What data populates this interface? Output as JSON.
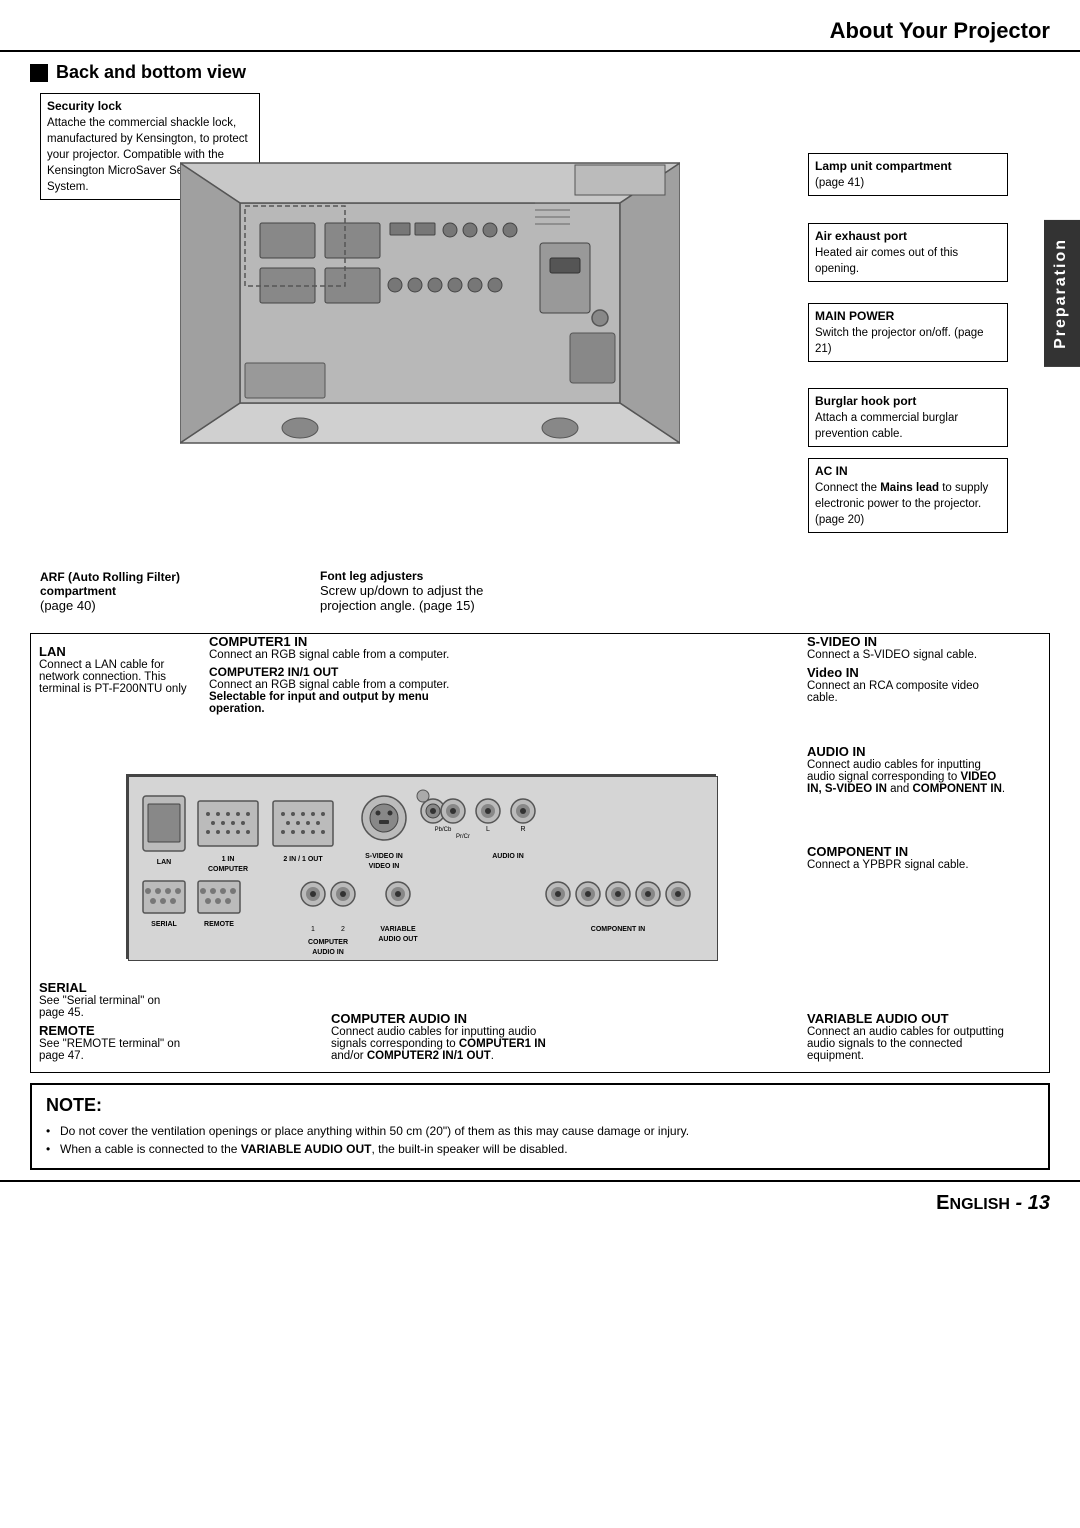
{
  "header": {
    "title": "About Your Projector"
  },
  "side_tab": "Preparation",
  "section": {
    "title": "Back and bottom view"
  },
  "annotations_top_left": {
    "security_lock": {
      "title": "Security lock",
      "lines": [
        "Attache the commercial shackle",
        "lock, manufactured by Kensington,",
        "to protect your projector.",
        "Compatible with the Kensington",
        "MicroSaver Security System."
      ]
    }
  },
  "annotations_top_right": {
    "lamp_unit": {
      "title": "Lamp unit compartment",
      "desc": "(page 41)"
    },
    "air_exhaust": {
      "title": "Air exhaust port",
      "desc": "Heated air comes out of this opening."
    },
    "main_power": {
      "title": "MAIN POWER",
      "desc": "Switch the projector on/off. (page 21)"
    },
    "burglar_hook": {
      "title": "Burglar hook port",
      "desc": "Attach a commercial burglar prevention cable."
    },
    "ac_in": {
      "title": "AC IN",
      "desc": "Connect the Mains lead to supply electronic power to the projector. (page 20)",
      "bold_word": "Mains lead"
    }
  },
  "annotations_bottom_left": {
    "arf": {
      "title": "ARF (Auto Rolling Filter) compartment",
      "desc": "(page 40)"
    },
    "font_leg": {
      "title": "Font leg adjusters",
      "desc": "Screw up/down to adjust the projection angle. (page 15)"
    }
  },
  "annotations_ports_left": {
    "lan": {
      "title": "LAN",
      "desc": "Connect a LAN cable for network connection. This terminal is PT-F200NTU only"
    },
    "computer1": {
      "title": "COMPUTER1 IN",
      "desc": "Connect an RGB signal cable from a computer."
    },
    "computer2": {
      "title": "COMPUTER2 IN/1 OUT",
      "desc": "Connect an RGB signal cable from a computer. Selectable for input and output by menu operation.",
      "bold": "Selectable for input and output by menu operation."
    }
  },
  "annotations_ports_right": {
    "svideo": {
      "title": "S-VIDEO IN",
      "desc": "Connect a S-VIDEO signal cable."
    },
    "video": {
      "title": "Video IN",
      "desc": "Connect an RCA composite video cable."
    },
    "audio_in": {
      "title": "AUDIO IN",
      "desc": "Connect audio cables for inputting audio signal corresponding to VIDEO IN, S-VIDEO IN and COMPONENT IN.",
      "bold": "VIDEO IN, S-VIDEO IN and COMPONENT IN."
    },
    "component_in": {
      "title": "COMPONENT IN",
      "desc": "Connect a YPBPR signal cable."
    }
  },
  "annotations_ports_bottom": {
    "serial": {
      "title": "SERIAL",
      "desc": "See \"Serial terminal\" on page 45."
    },
    "remote": {
      "title": "REMOTE",
      "desc": "See \"REMOTE terminal\" on page 47."
    },
    "computer_audio": {
      "title": "COMPUTER AUDIO IN",
      "desc": "Connect audio cables for inputting audio signals corresponding to COMPUTER1 IN and/or COMPUTER2 IN/1 OUT.",
      "bold": "COMPUTER1 IN and/or COMPUTER2 IN/1 OUT."
    },
    "variable_audio": {
      "title": "VARIABLE AUDIO OUT",
      "desc": "Connect an audio cables for outputting audio signals to the connected equipment."
    }
  },
  "note": {
    "title": "NOTE:",
    "items": [
      "Do not cover the ventilation openings or place anything within 50 cm (20\") of them as this may cause damage or injury.",
      "When a cable is connected to the VARIABLE AUDIO OUT, the built-in speaker will be disabled."
    ]
  },
  "footer": {
    "text": "ENGLISH - 13"
  },
  "port_labels": {
    "row1": [
      "LAN",
      "1 IN",
      "2 IN / 1 OUT",
      "S-VIDEO IN",
      "AUDIO IN"
    ],
    "row1_sub": [
      "",
      "COMPUTER",
      "",
      "VIDEO IN",
      ""
    ],
    "row2": [
      "SERIAL",
      "REMOTE",
      "COMPUTER",
      "VARIABLE",
      "COMPONENT IN"
    ],
    "row2_sub": [
      "",
      "",
      "AUDIO IN",
      "AUDIO OUT",
      ""
    ]
  }
}
